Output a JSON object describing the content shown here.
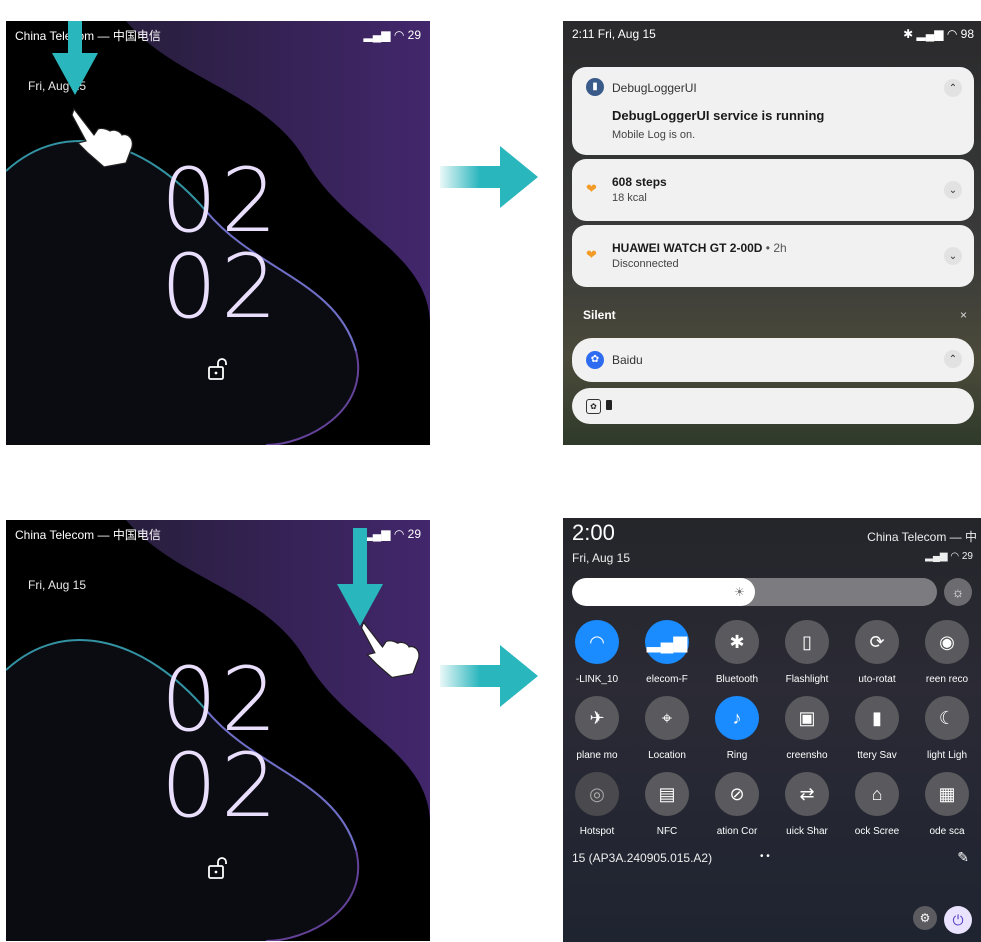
{
  "panel1": {
    "carrier": "China Telecom — 中国电信",
    "status_icons": "▂▄▆ ◠ 29",
    "date": "Fri, Aug 15",
    "clock_hour": "02",
    "clock_minute": "02"
  },
  "panel2": {
    "time_date": "2:11  Fri, Aug 15",
    "status_icons": "✱ ▂▄▆ ◠ 98",
    "card1": {
      "app": "DebugLoggerUI",
      "title": "DebugLoggerUI service is running",
      "body": "Mobile Log is on."
    },
    "card2": {
      "title": "608 steps",
      "body": "18 kcal"
    },
    "card3": {
      "title": "HUAWEI WATCH GT 2-00D",
      "time": " • 2h",
      "body": "Disconnected"
    },
    "silent_label": "Silent",
    "close": "×",
    "card4": {
      "app": "Baidu"
    }
  },
  "panel3": {
    "carrier": "China Telecom — 中国电信",
    "status_icons": "▂▄▆ ◠ 29",
    "date": "Fri, Aug 15",
    "clock_hour": "02",
    "clock_minute": "02"
  },
  "panel4": {
    "time": "2:00",
    "date": "Fri, Aug 15",
    "carrier": "China Telecom — 中",
    "status_icons": "▂▄▆ ◠ 29",
    "brightness_level": 0.5,
    "tiles": [
      {
        "label": "-LINK_10",
        "icon": "wifi-icon",
        "glyph": "◠",
        "state": "on"
      },
      {
        "label": "elecom-F",
        "icon": "mobile-data-icon",
        "glyph": "▂▄▆",
        "state": "on"
      },
      {
        "label": "Bluetooth",
        "icon": "bluetooth-icon",
        "glyph": "✱",
        "state": "off"
      },
      {
        "label": "Flashlight",
        "icon": "flashlight-icon",
        "glyph": "▯",
        "state": "off"
      },
      {
        "label": "uto-rotat",
        "icon": "auto-rotate-icon",
        "glyph": "⟳",
        "state": "off"
      },
      {
        "label": "reen reco",
        "icon": "screen-record-icon",
        "glyph": "◉",
        "state": "off"
      },
      {
        "label": "plane mo",
        "icon": "airplane-icon",
        "glyph": "✈",
        "state": "off"
      },
      {
        "label": "Location",
        "icon": "location-off-icon",
        "glyph": "⌖",
        "state": "off"
      },
      {
        "label": "Ring",
        "icon": "ring-icon",
        "glyph": "♪",
        "state": "on"
      },
      {
        "label": "creensho",
        "icon": "screenshot-icon",
        "glyph": "▣",
        "state": "off"
      },
      {
        "label": "ttery Sav",
        "icon": "battery-saver-icon",
        "glyph": "▮",
        "state": "off"
      },
      {
        "label": "light Ligh",
        "icon": "night-light-icon",
        "glyph": "☾",
        "state": "off"
      },
      {
        "label": "Hotspot",
        "icon": "hotspot-icon",
        "glyph": "◎",
        "state": "dim"
      },
      {
        "label": "NFC",
        "icon": "nfc-icon",
        "glyph": "▤",
        "state": "off"
      },
      {
        "label": "ation Cor",
        "icon": "rotation-control-icon",
        "glyph": "⊘",
        "state": "off"
      },
      {
        "label": "uick Shar",
        "icon": "quick-share-icon",
        "glyph": "⇄",
        "state": "off"
      },
      {
        "label": "ock Scree",
        "icon": "lock-screen-icon",
        "glyph": "⌂",
        "state": "off"
      },
      {
        "label": "ode sca",
        "icon": "qr-code-scan-icon",
        "glyph": "▦",
        "state": "off"
      }
    ],
    "build": "15 (AP3A.240905.015.A2)",
    "dots": "• •",
    "edit": "✎"
  },
  "colors": {
    "teal_arrow": "#2ab6bd",
    "accent_blue": "#1a8cff",
    "clock": "#e9defc"
  }
}
